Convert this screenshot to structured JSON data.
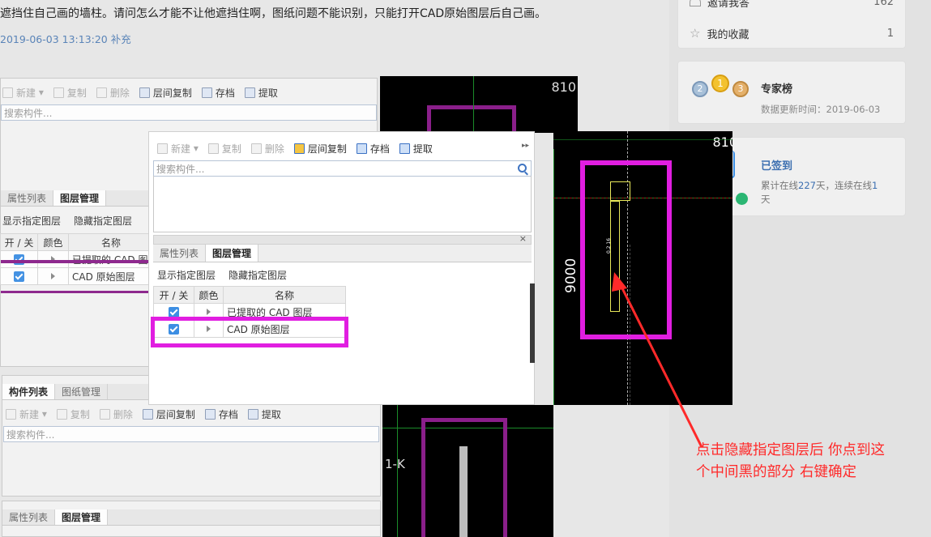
{
  "question": {
    "text": "遮挡住自己画的墙柱。请问怎么才能不让他遮挡住啊，图纸问题不能识别，只能打开CAD原始图层后自己画。",
    "timestamp": "2019-06-03 13:13:20 补充"
  },
  "sidebar": {
    "invite": {
      "label": "邀请我答",
      "count": "162"
    },
    "favorites": {
      "label": "我的收藏",
      "count": "1"
    },
    "experts": {
      "title": "专家榜",
      "updated": "数据更新时间：2019-06-03",
      "medals": [
        "2",
        "1",
        "3"
      ]
    },
    "signin": {
      "title": "已签到",
      "line1_prefix": "累计在线",
      "total_days": "227",
      "line1_mid": "天，连续在线",
      "streak": "1",
      "line2": "天"
    }
  },
  "panel": {
    "toolbar": {
      "new": "新建",
      "copy": "复制",
      "delete": "删除",
      "floor_copy": "层间复制",
      "archive": "存档",
      "extract": "提取"
    },
    "search_placeholder": "搜索构件...",
    "tabs": {
      "properties": "属性列表",
      "layers": "图层管理",
      "components": "构件列表",
      "drawings": "图纸管理"
    },
    "layer_buttons": {
      "show": "显示指定图层",
      "hide": "隐藏指定图层"
    },
    "table_headers": {
      "toggle": "开 / 关",
      "color": "颜色",
      "name": "名称"
    },
    "layers": [
      {
        "name": "已提取的 CAD 图层"
      },
      {
        "name": "CAD 原始图层"
      }
    ],
    "layers_bg": [
      {
        "name": "已提取的 CAD 图"
      },
      {
        "name": "CAD 原始图层"
      }
    ]
  },
  "cad": {
    "dim_top": "810",
    "axis_label": "1-K",
    "dim_side": "9000",
    "small_text": "0.2 16"
  },
  "annotation": {
    "line1": "点击隐藏指定图层后 你点到这",
    "line2": "个中间黑的部分 右键确定"
  },
  "colors": {
    "highlight": "#e11ee1",
    "arrow": "#ff2a2a",
    "accent": "#3c8ee3",
    "link": "#5a84b8"
  }
}
